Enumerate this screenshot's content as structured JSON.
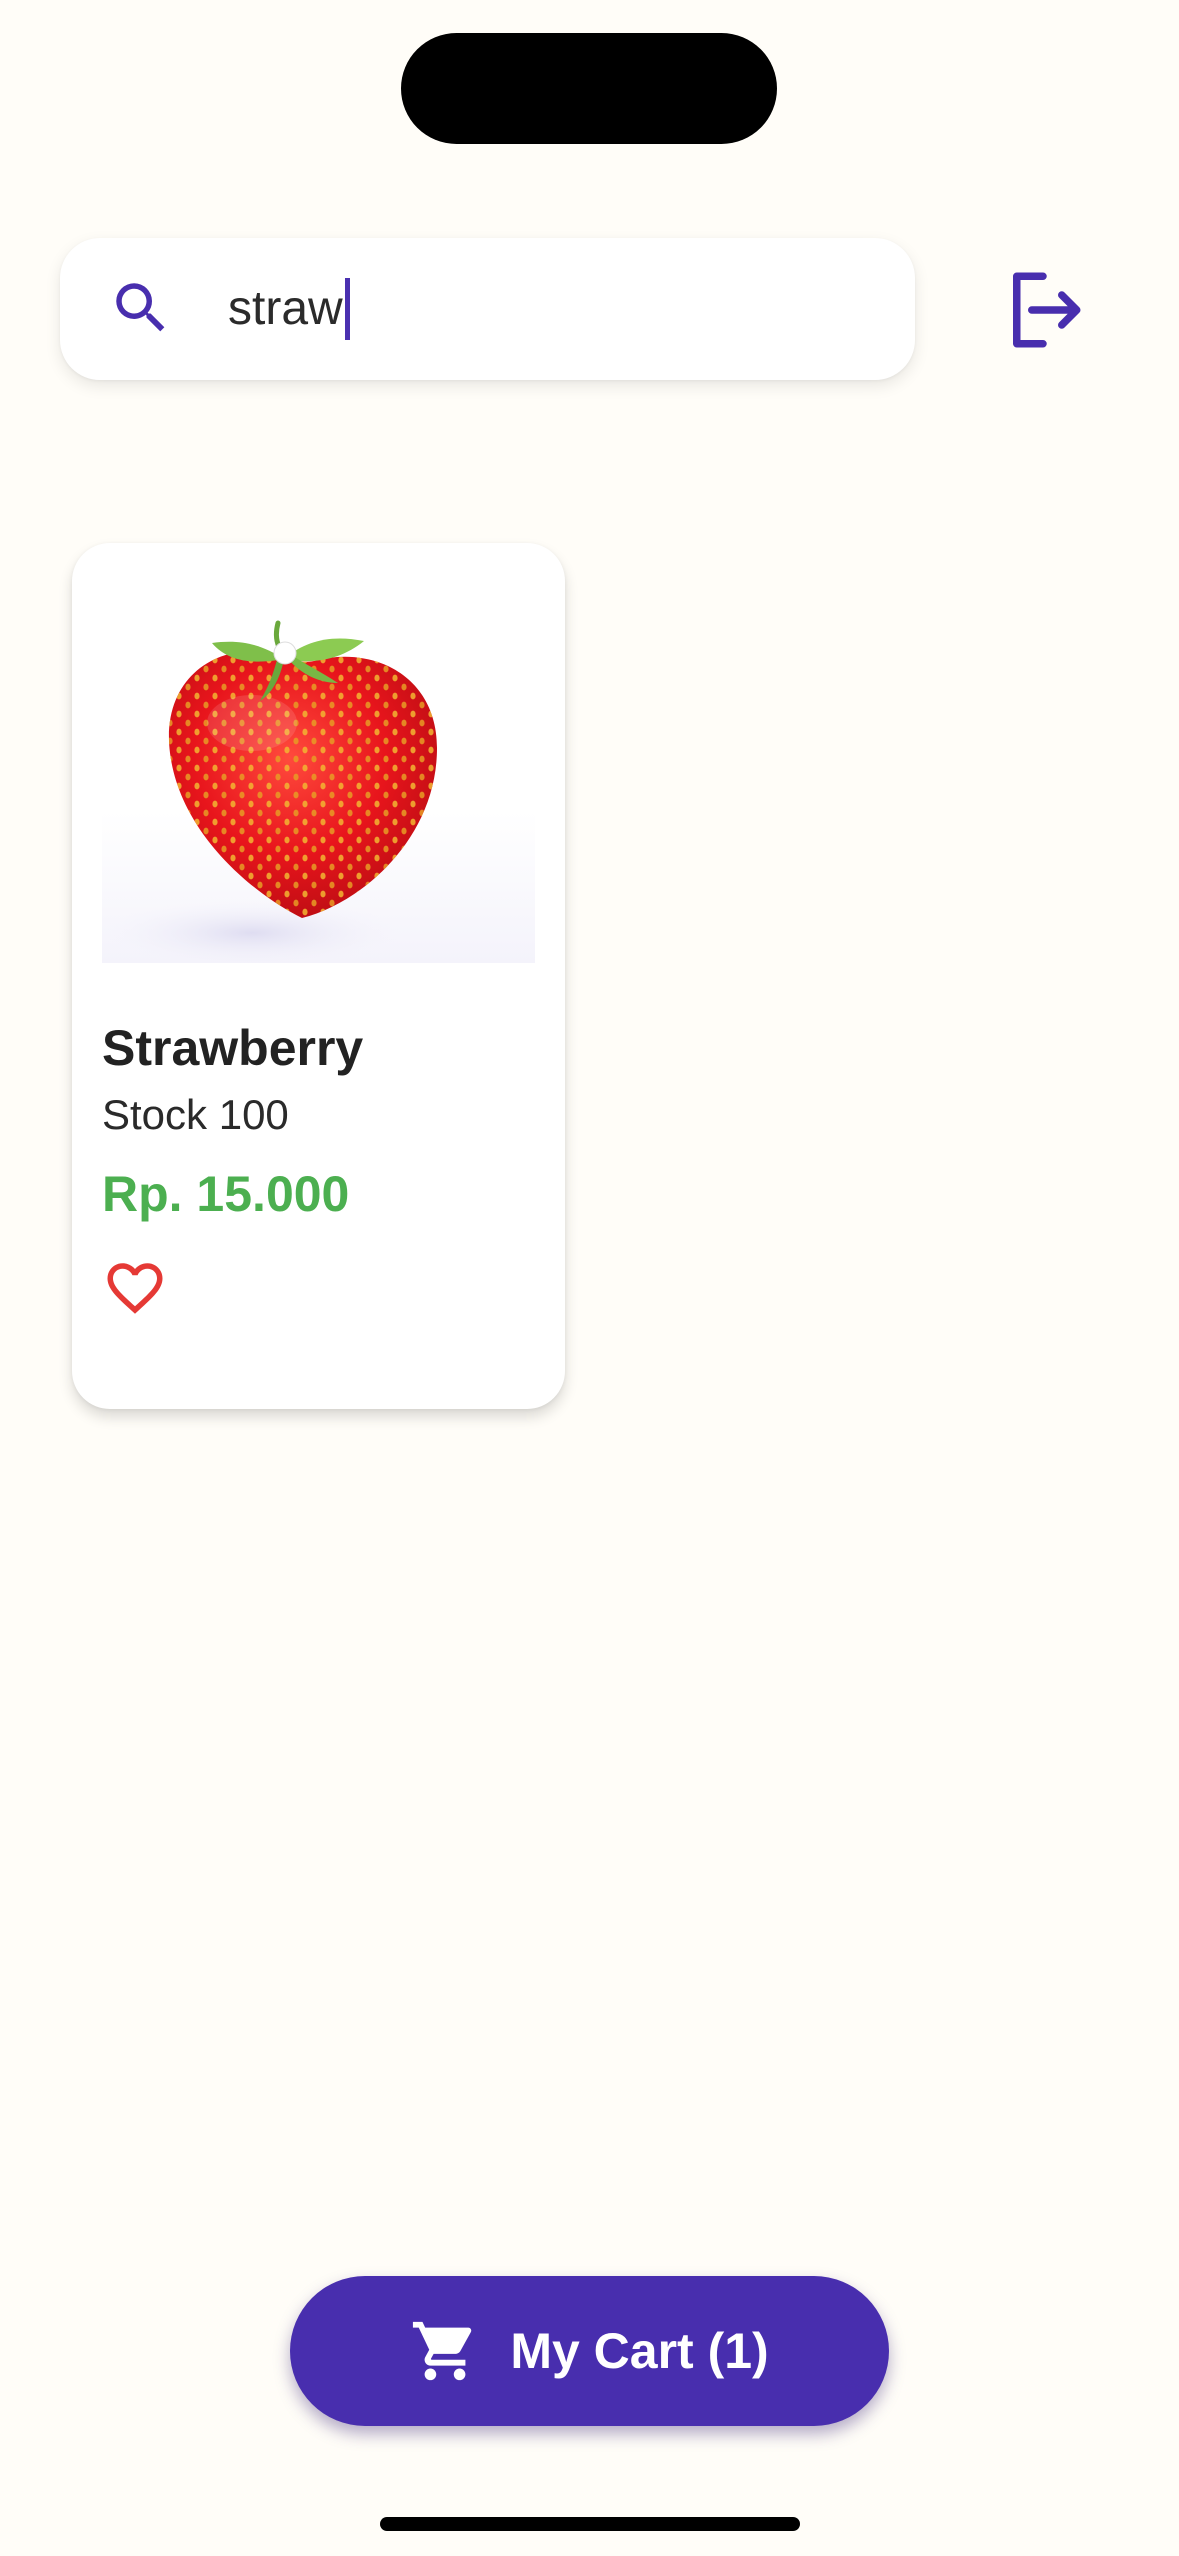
{
  "search": {
    "value": "straw"
  },
  "header": {
    "logout_icon": "logout-icon"
  },
  "products": [
    {
      "name": "Strawberry",
      "stock": "Stock 100",
      "price": "Rp. 15.000",
      "image_icon": "strawberry-image",
      "favorite_icon": "heart-outline-icon",
      "favorited": false
    }
  ],
  "cart": {
    "label": "My Cart (1)",
    "icon": "shopping-cart-icon"
  },
  "colors": {
    "accent": "#482eae",
    "price": "#4caf50",
    "favorite": "#e53935",
    "background": "#fffdf8"
  }
}
